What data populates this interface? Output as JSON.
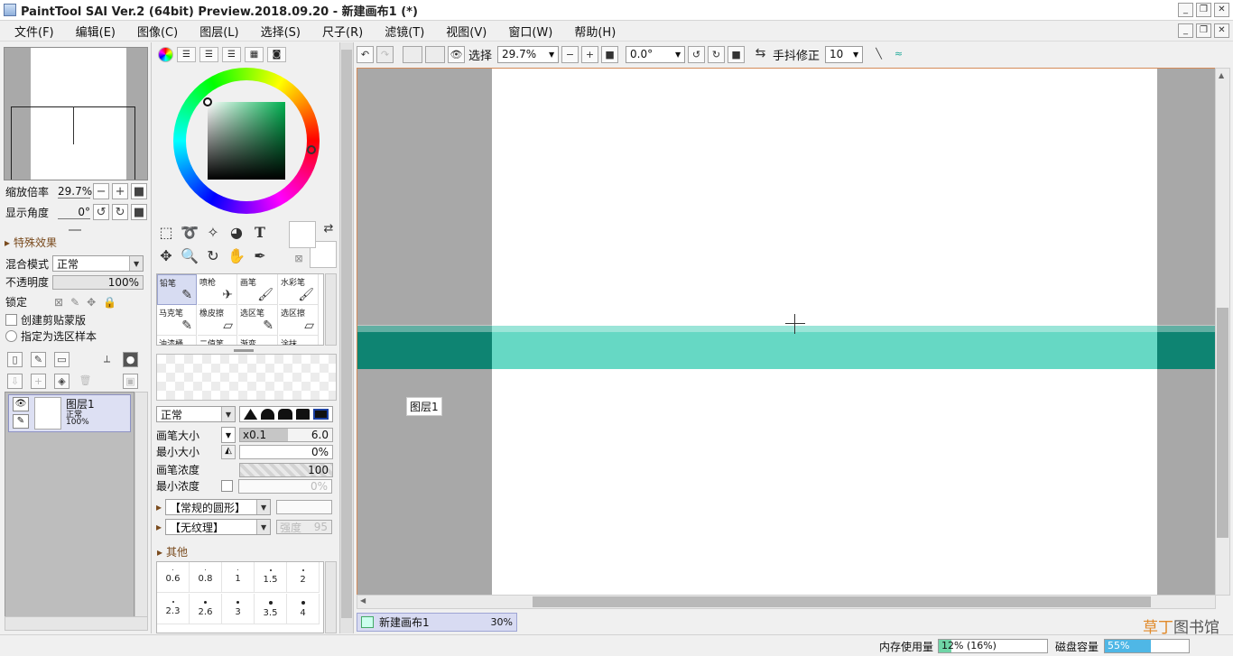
{
  "window": {
    "title": "PaintTool SAI Ver.2 (64bit) Preview.2018.09.20 - 新建画布1 (*)",
    "controls": [
      "_",
      "❐",
      "✕"
    ]
  },
  "menu": [
    "文件(F)",
    "编辑(E)",
    "图像(C)",
    "图层(L)",
    "选择(S)",
    "尺子(R)",
    "滤镜(T)",
    "视图(V)",
    "窗口(W)",
    "帮助(H)"
  ],
  "navigator": {
    "zoom_label": "缩放倍率",
    "zoom_value": "29.7%",
    "angle_label": "显示角度",
    "angle_value": "0°"
  },
  "layer_panel": {
    "effects_header": "特殊效果",
    "blend_label": "混合模式",
    "blend_value": "正常",
    "opacity_label": "不透明度",
    "opacity_value": "100%",
    "opacity_fraction": 1.0,
    "lock_label": "锁定",
    "clipping_label": "创建剪贴蒙版",
    "sample_label": "指定为选区样本",
    "layers": [
      {
        "name": "图层1",
        "mode": "正常",
        "opacity": "100%"
      }
    ]
  },
  "tools": {
    "color_tabs": [
      "color-wheel",
      "rgb-sliders",
      "hsv-sliders",
      "palette",
      "swatches",
      "scratchpad"
    ],
    "select_tools": [
      "rect-select-icon",
      "lasso-icon",
      "magic-wand-icon",
      "bucket-icon",
      "text-icon"
    ],
    "nav_tools": [
      "move-icon",
      "zoom-icon",
      "rotate-icon",
      "hand-icon",
      "eyedropper-icon"
    ],
    "text_tool_glyph": "T"
  },
  "brushes": [
    {
      "name": "铅笔",
      "icon": "✎"
    },
    {
      "name": "喷枪",
      "icon": "✈"
    },
    {
      "name": "画笔",
      "icon": "🖌"
    },
    {
      "name": "水彩笔",
      "icon": "🖌"
    },
    {
      "name": "马克笔",
      "icon": "✎"
    },
    {
      "name": "橡皮擦",
      "icon": "▱"
    },
    {
      "name": "选区笔",
      "icon": "✎"
    },
    {
      "name": "选区擦",
      "icon": "▱"
    },
    {
      "name": "油漆桶",
      "icon": ""
    },
    {
      "name": "二值笔",
      "icon": ""
    },
    {
      "name": "渐变",
      "icon": ""
    },
    {
      "name": "涂抹",
      "icon": ""
    }
  ],
  "brush_settings": {
    "mode_value": "正常",
    "size_label": "画笔大小",
    "size_multiplier": "x0.1",
    "size_value": "6.0",
    "min_size_label": "最小大小",
    "min_size_value": "0%",
    "density_label": "画笔浓度",
    "density_value": "100",
    "min_density_label": "最小浓度",
    "min_density_value": "0%",
    "shape_value": "【常规的圆形】",
    "texture_value": "【无纹理】",
    "texture_strength_label": "强度",
    "texture_strength_value": "95",
    "other_header": "其他"
  },
  "brush_sizes": [
    "0.6",
    "0.8",
    "1",
    "1.5",
    "2",
    "2.3",
    "2.6",
    "3",
    "3.5",
    "4"
  ],
  "canvas_toolbar": {
    "selection_label": "选择",
    "zoom_value": "29.7%",
    "angle_value": "0.0°",
    "stabilizer_label": "手抖修正",
    "stabilizer_value": "10"
  },
  "canvas": {
    "layer_label": "图层1",
    "band_color_outside": "#0e8472",
    "band_color_paper": "#66d8c4"
  },
  "document_tab": {
    "name": "新建画布1",
    "zoom": "30%"
  },
  "status": {
    "memory_label": "内存使用量",
    "memory_value": "12% (16%)",
    "memory_fraction": 0.12,
    "disk_label": "磁盘容量",
    "disk_value": "55%",
    "disk_fraction": 0.55
  },
  "watermark": {
    "part1": "草丁",
    "part2": "图书馆"
  }
}
